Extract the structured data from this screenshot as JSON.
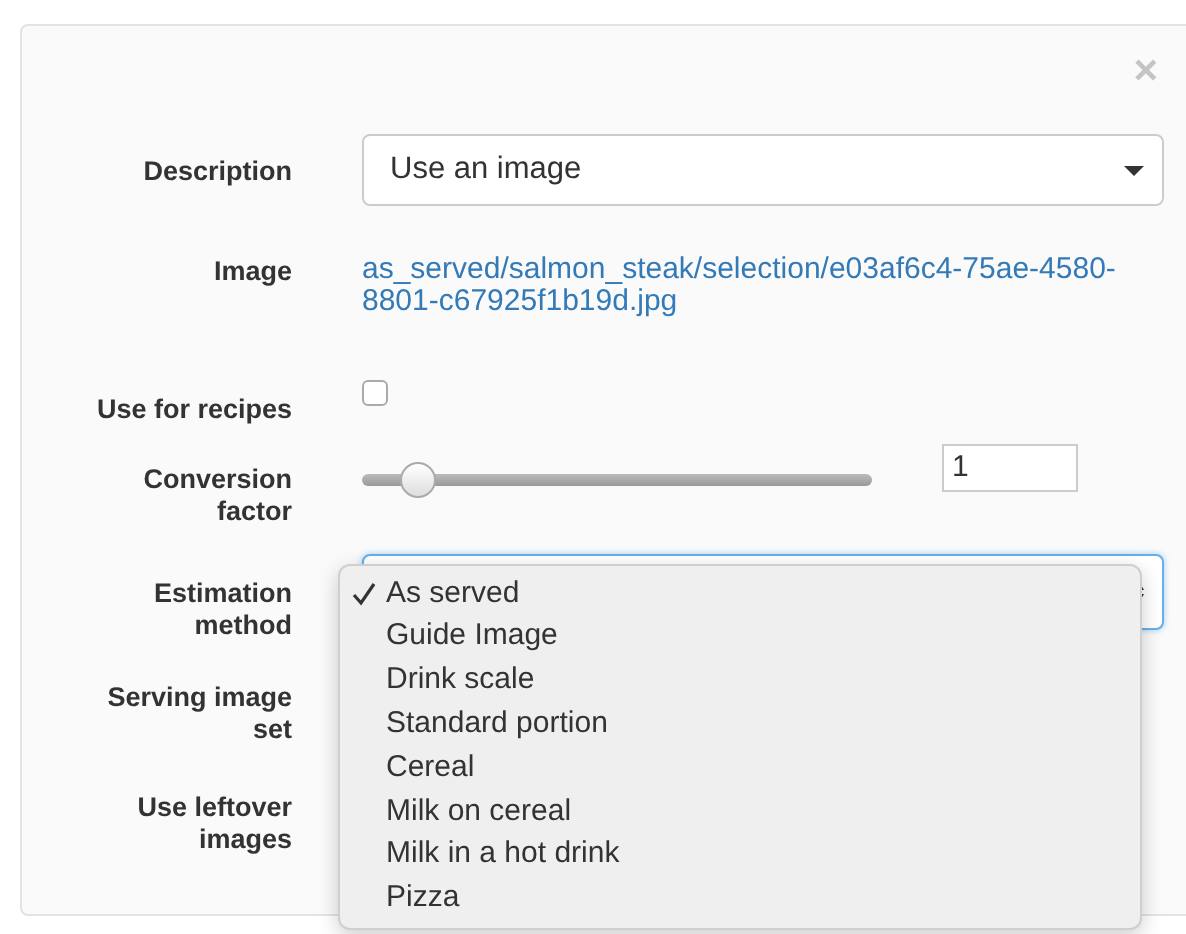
{
  "close": "×",
  "fields": [
    {
      "kind": "select",
      "label": "Description",
      "value": "Use an image"
    },
    {
      "kind": "link",
      "label": "Image",
      "value": "as_served/salmon_steak/selection/e03af6c4-75ae-4580-8801-c67925f1b19d.jpg"
    },
    {
      "kind": "checkbox",
      "label": "Use for recipes",
      "checked": false
    },
    {
      "kind": "slider",
      "label": "Conversion factor",
      "level": 0.11,
      "value": "1"
    },
    {
      "kind": "open-select",
      "label": "Estimation method",
      "options": [
        {
          "label": "As served",
          "selected": true
        },
        {
          "label": "Guide Image",
          "selected": false
        },
        {
          "label": "Drink scale",
          "selected": false
        },
        {
          "label": "Standard portion",
          "selected": false
        },
        {
          "label": "Cereal",
          "selected": false
        },
        {
          "label": "Milk on cereal",
          "selected": false
        },
        {
          "label": "Milk in a hot drink",
          "selected": false
        },
        {
          "label": "Pizza",
          "selected": false
        }
      ]
    },
    {
      "kind": "empty",
      "label": "Serving image set"
    },
    {
      "kind": "empty",
      "label": "Use leftover images"
    }
  ]
}
